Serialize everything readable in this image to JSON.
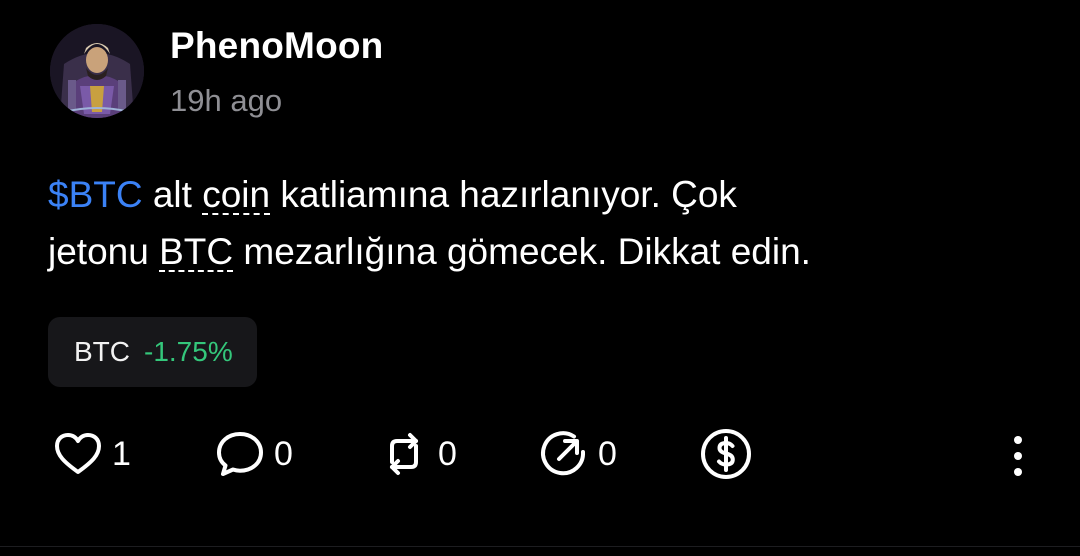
{
  "post": {
    "author": "PhenoMoon",
    "time": "19h ago",
    "content": {
      "line1": {
        "cashtag": "$BTC",
        "t1": " alt ",
        "u1": "coin",
        "t2": " katliamına hazırlanıyor. Çok"
      },
      "line2": {
        "t1": "jetonu ",
        "u1": "BTC",
        "t2": " mezarlığına gömecek. Dikkat edin."
      }
    },
    "ticker": {
      "symbol": "BTC",
      "change": "-1.75%"
    },
    "actions": {
      "like_count": "1",
      "comment_count": "0",
      "repost_count": "0",
      "share_count": "0"
    }
  },
  "icons": {
    "like": "heart-icon",
    "comment": "comment-bubble-icon",
    "repost": "repost-icon",
    "share": "share-icon",
    "tip": "dollar-tip-icon",
    "more": "more-vertical-icon"
  },
  "colors": {
    "background": "#000000",
    "cashtag": "#3b82f6",
    "positive_change": "#34c77b",
    "muted_text": "#8f8f94",
    "chip_background": "#17171a"
  }
}
